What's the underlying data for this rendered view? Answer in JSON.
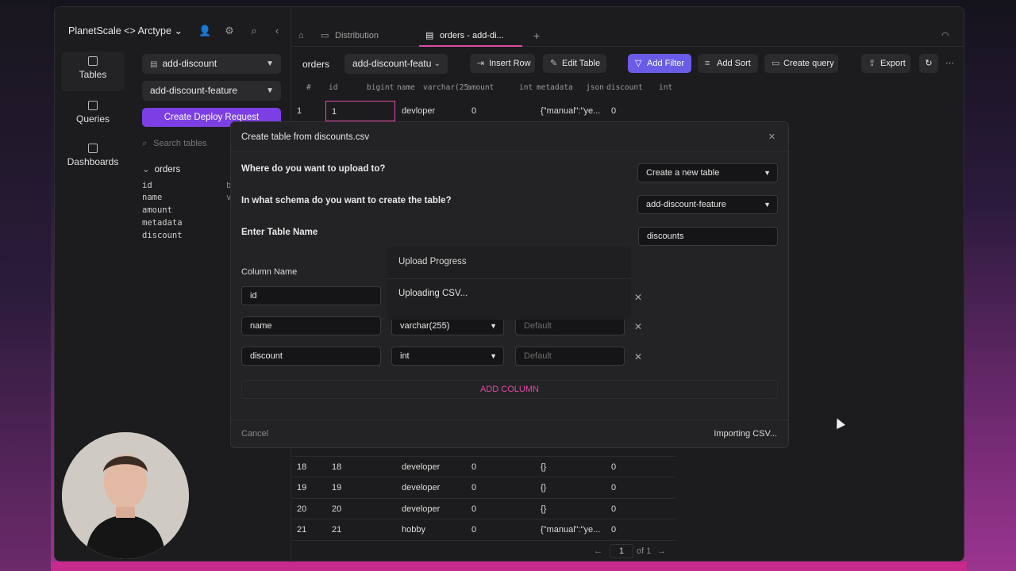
{
  "app": {
    "title": "PlanetScale <> Arctype",
    "title_chevron": "chevron-down-icon",
    "header_icons": [
      "user-icon",
      "gear-icon",
      "search-icon",
      "chevron-left-icon"
    ]
  },
  "nav": {
    "items": [
      {
        "label": "Tables",
        "icon": "table-icon"
      },
      {
        "label": "Queries",
        "icon": "terminal-icon"
      },
      {
        "label": "Dashboards",
        "icon": "chart-icon"
      }
    ]
  },
  "sidebar": {
    "branch_select": "add-discount",
    "schema_select": "add-discount-feature",
    "deploy_button": "Create Deploy Request",
    "search_placeholder": "Search tables",
    "table": "orders",
    "columns": [
      {
        "name": "id",
        "type": "b"
      },
      {
        "name": "name",
        "type": "v"
      },
      {
        "name": "amount",
        "type": ""
      },
      {
        "name": "metadata",
        "type": ""
      },
      {
        "name": "discount",
        "type": ""
      }
    ]
  },
  "tabs": [
    {
      "label": "Distribution",
      "active": false
    },
    {
      "label": "orders - add-di...",
      "active": true
    }
  ],
  "toolbar": {
    "table": "orders",
    "branch": "add-discount-featu",
    "insert_row": "Insert Row",
    "edit_table": "Edit Table",
    "add_filter": "Add Filter",
    "add_sort": "Add Sort",
    "create_query": "Create query",
    "export": "Export"
  },
  "grid": {
    "headers": [
      {
        "name": "#",
        "type": ""
      },
      {
        "name": "id",
        "type": "bigint"
      },
      {
        "name": "name",
        "type": "varchar(25"
      },
      {
        "name": "amount",
        "type": "int"
      },
      {
        "name": "metadata",
        "type": "json"
      },
      {
        "name": "discount",
        "type": "int"
      }
    ],
    "top_row": [
      "1",
      "1",
      "devloper",
      "0",
      "{\"manual\":\"ye...",
      "0"
    ],
    "bottom_rows": [
      [
        "18",
        "18",
        "developer",
        "0",
        "{}",
        "0"
      ],
      [
        "19",
        "19",
        "developer",
        "0",
        "{}",
        "0"
      ],
      [
        "20",
        "20",
        "developer",
        "0",
        "{}",
        "0"
      ],
      [
        "21",
        "21",
        "hobby",
        "0",
        "{\"manual\":\"ye...",
        "0"
      ]
    ],
    "pager": {
      "page": "1",
      "of": "of 1"
    }
  },
  "modal": {
    "title": "Create table from discounts.csv",
    "q_upload": "Where do you want to upload to?",
    "upload_select": "Create a new table",
    "q_schema": "In what schema do you want to create the table?",
    "schema_select": "add-discount-feature",
    "q_name": "Enter Table Name",
    "table_name": "discounts",
    "column_name_label": "Column Name",
    "columns": [
      {
        "name": "id",
        "type": "",
        "default": ""
      },
      {
        "name": "name",
        "type": "varchar(255)",
        "default": "Default"
      },
      {
        "name": "discount",
        "type": "int",
        "default": "Default"
      }
    ],
    "add_column": "ADD COLUMN",
    "cancel": "Cancel",
    "status": "Importing CSV..."
  },
  "progress": {
    "title": "Upload Progress",
    "text": "Uploading CSV..."
  },
  "colors": {
    "accent_pink": "#e04aa8",
    "purple": "#7b3fe4",
    "filter": "#6b5ce7"
  }
}
